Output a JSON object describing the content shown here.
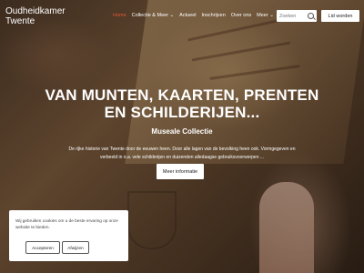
{
  "brand": {
    "line1": "Oudheidkamer",
    "line2": "Twente"
  },
  "nav": {
    "items": [
      {
        "label": "Home",
        "active": true
      },
      {
        "label": "Collectie & Meer ⌄",
        "active": false
      },
      {
        "label": "Actueel",
        "active": false
      },
      {
        "label": "Inschrijven",
        "active": false
      },
      {
        "label": "Over ons",
        "active": false
      },
      {
        "label": "Meer ⌄",
        "active": false
      }
    ]
  },
  "search": {
    "placeholder": "Zoeken"
  },
  "join_button": "Lid worden",
  "hero": {
    "title_line1": "VAN MUNTEN, KAARTEN, PRENTEN",
    "title_line2": "EN SCHILDERIJEN...",
    "subtitle": "Museale Collectie",
    "description_line1": "De rijke historie van Twente door de eeuwen heen. Door alle lagen van de bevolking heen ook. Vormgegeven en",
    "description_line2": "verbeeld in o.a. vele schilderijen en duizenden alledaagse gebruiksvoorwerpen ...",
    "more_button": "Meer informatie"
  },
  "cookie": {
    "message": "Wij gebruiken cookies om u de beste ervaring op onze website te bieden.",
    "accept_label": "Accepteren",
    "reject_label": "Afwijzen"
  },
  "colors": {
    "accent": "#e0553a"
  }
}
